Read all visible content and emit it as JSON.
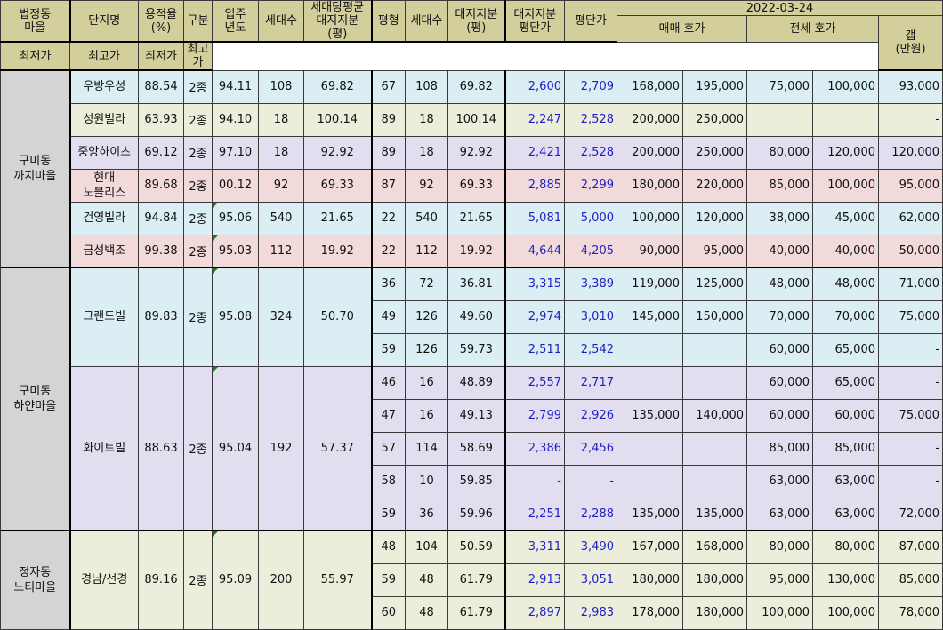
{
  "header": {
    "region": "법정동\n마을",
    "complex": "단지명",
    "far": "용적율\n(%)",
    "zone": "구분",
    "year": "입주\n년도",
    "units": "세대수",
    "avg_land": "세대당평균\n대지지분\n(평)",
    "pyeong": "평형",
    "type_units": "세대수",
    "land": "대지지분\n(평)",
    "land_price": "대지지분\n평단가",
    "pyeong_price": "평단가",
    "date": "2022-03-24",
    "sale": "매매 호가",
    "jeonse": "전세 호가",
    "min": "최저가",
    "max": "최고가",
    "gap": "갭\n(만원)"
  },
  "groups": [
    {
      "region": "구미동\n까치마을",
      "complexes": [
        {
          "name": "우방우성",
          "bg": "blue",
          "far": "88.54",
          "zone": "2종",
          "year": "94.11",
          "units": "108",
          "avg_land": "69.82",
          "marker": false,
          "rows": [
            {
              "pyeong": "67",
              "units": "108",
              "land": "69.82",
              "land_price": "2,600",
              "pyeong_price": "2,709",
              "sale_min": "168,000",
              "sale_max": "195,000",
              "jeonse_min": "75,000",
              "jeonse_max": "100,000",
              "gap": "93,000"
            }
          ]
        },
        {
          "name": "성원빌라",
          "bg": "green",
          "far": "63.93",
          "zone": "2종",
          "year": "94.10",
          "units": "18",
          "avg_land": "100.14",
          "marker": false,
          "rows": [
            {
              "pyeong": "89",
              "units": "18",
              "land": "100.14",
              "land_price": "2,247",
              "pyeong_price": "2,528",
              "sale_min": "200,000",
              "sale_max": "250,000",
              "jeonse_min": "",
              "jeonse_max": "",
              "gap": "-"
            }
          ]
        },
        {
          "name": "중앙하이츠",
          "bg": "purple",
          "far": "69.12",
          "zone": "2종",
          "year": "97.10",
          "units": "18",
          "avg_land": "92.92",
          "marker": false,
          "rows": [
            {
              "pyeong": "89",
              "units": "18",
              "land": "92.92",
              "land_price": "2,421",
              "pyeong_price": "2,528",
              "sale_min": "200,000",
              "sale_max": "250,000",
              "jeonse_min": "80,000",
              "jeonse_max": "120,000",
              "gap": "120,000"
            }
          ]
        },
        {
          "name": "현대\n노블리스",
          "bg": "pink",
          "far": "89.68",
          "zone": "2종",
          "year": "00.12",
          "units": "92",
          "avg_land": "69.33",
          "marker": false,
          "rows": [
            {
              "pyeong": "87",
              "units": "92",
              "land": "69.33",
              "land_price": "2,885",
              "pyeong_price": "2,299",
              "sale_min": "180,000",
              "sale_max": "220,000",
              "jeonse_min": "85,000",
              "jeonse_max": "100,000",
              "gap": "95,000"
            }
          ]
        },
        {
          "name": "건영빌라",
          "bg": "blue",
          "far": "94.84",
          "zone": "2종",
          "year": "95.06",
          "units": "540",
          "avg_land": "21.65",
          "marker": true,
          "rows": [
            {
              "pyeong": "22",
              "units": "540",
              "land": "21.65",
              "land_price": "5,081",
              "pyeong_price": "5,000",
              "sale_min": "100,000",
              "sale_max": "120,000",
              "jeonse_min": "38,000",
              "jeonse_max": "45,000",
              "gap": "62,000"
            }
          ]
        },
        {
          "name": "금성백조",
          "bg": "pink",
          "far": "99.38",
          "zone": "2종",
          "year": "95.03",
          "units": "112",
          "avg_land": "19.92",
          "marker": true,
          "rows": [
            {
              "pyeong": "22",
              "units": "112",
              "land": "19.92",
              "land_price": "4,644",
              "pyeong_price": "4,205",
              "sale_min": "90,000",
              "sale_max": "95,000",
              "jeonse_min": "40,000",
              "jeonse_max": "40,000",
              "gap": "50,000"
            }
          ]
        }
      ]
    },
    {
      "region": "구미동\n하얀마을",
      "complexes": [
        {
          "name": "그랜드빌",
          "bg": "blue",
          "far": "89.83",
          "zone": "2종",
          "year": "95.08",
          "units": "324",
          "avg_land": "50.70",
          "marker": true,
          "rows": [
            {
              "pyeong": "36",
              "units": "72",
              "land": "36.81",
              "land_price": "3,315",
              "pyeong_price": "3,389",
              "sale_min": "119,000",
              "sale_max": "125,000",
              "jeonse_min": "48,000",
              "jeonse_max": "48,000",
              "gap": "71,000"
            },
            {
              "pyeong": "49",
              "units": "126",
              "land": "49.60",
              "land_price": "2,974",
              "pyeong_price": "3,010",
              "sale_min": "145,000",
              "sale_max": "150,000",
              "jeonse_min": "70,000",
              "jeonse_max": "70,000",
              "gap": "75,000"
            },
            {
              "pyeong": "59",
              "units": "126",
              "land": "59.73",
              "land_price": "2,511",
              "pyeong_price": "2,542",
              "sale_min": "",
              "sale_max": "",
              "jeonse_min": "60,000",
              "jeonse_max": "65,000",
              "gap": "-"
            }
          ]
        },
        {
          "name": "화이트빌",
          "bg": "purple",
          "far": "88.63",
          "zone": "2종",
          "year": "95.04",
          "units": "192",
          "avg_land": "57.37",
          "marker": true,
          "rows": [
            {
              "pyeong": "46",
              "units": "16",
              "land": "48.89",
              "land_price": "2,557",
              "pyeong_price": "2,717",
              "sale_min": "",
              "sale_max": "",
              "jeonse_min": "60,000",
              "jeonse_max": "65,000",
              "gap": "-"
            },
            {
              "pyeong": "47",
              "units": "16",
              "land": "49.13",
              "land_price": "2,799",
              "pyeong_price": "2,926",
              "sale_min": "135,000",
              "sale_max": "140,000",
              "jeonse_min": "60,000",
              "jeonse_max": "60,000",
              "gap": "75,000"
            },
            {
              "pyeong": "57",
              "units": "114",
              "land": "58.69",
              "land_price": "2,386",
              "pyeong_price": "2,456",
              "sale_min": "",
              "sale_max": "",
              "jeonse_min": "85,000",
              "jeonse_max": "85,000",
              "gap": "-"
            },
            {
              "pyeong": "58",
              "units": "10",
              "land": "59.85",
              "land_price": "-",
              "pyeong_price": "-",
              "sale_min": "",
              "sale_max": "",
              "jeonse_min": "63,000",
              "jeonse_max": "63,000",
              "gap": "-"
            },
            {
              "pyeong": "59",
              "units": "36",
              "land": "59.96",
              "land_price": "2,251",
              "pyeong_price": "2,288",
              "sale_min": "135,000",
              "sale_max": "135,000",
              "jeonse_min": "63,000",
              "jeonse_max": "63,000",
              "gap": "72,000"
            }
          ]
        }
      ]
    },
    {
      "region": "정자동\n느티마을",
      "complexes": [
        {
          "name": "경남/선경",
          "bg": "green",
          "far": "89.16",
          "zone": "2종",
          "year": "95.09",
          "units": "200",
          "avg_land": "55.97",
          "marker": true,
          "rows": [
            {
              "pyeong": "48",
              "units": "104",
              "land": "50.59",
              "land_price": "3,311",
              "pyeong_price": "3,490",
              "sale_min": "167,000",
              "sale_max": "168,000",
              "jeonse_min": "80,000",
              "jeonse_max": "80,000",
              "gap": "87,000"
            },
            {
              "pyeong": "59",
              "units": "48",
              "land": "61.79",
              "land_price": "2,913",
              "pyeong_price": "3,051",
              "sale_min": "180,000",
              "sale_max": "180,000",
              "jeonse_min": "95,000",
              "jeonse_max": "130,000",
              "gap": "85,000"
            },
            {
              "pyeong": "60",
              "units": "48",
              "land": "61.79",
              "land_price": "2,897",
              "pyeong_price": "2,983",
              "sale_min": "178,000",
              "sale_max": "180,000",
              "jeonse_min": "100,000",
              "jeonse_max": "100,000",
              "gap": "78,000"
            }
          ]
        }
      ]
    }
  ]
}
